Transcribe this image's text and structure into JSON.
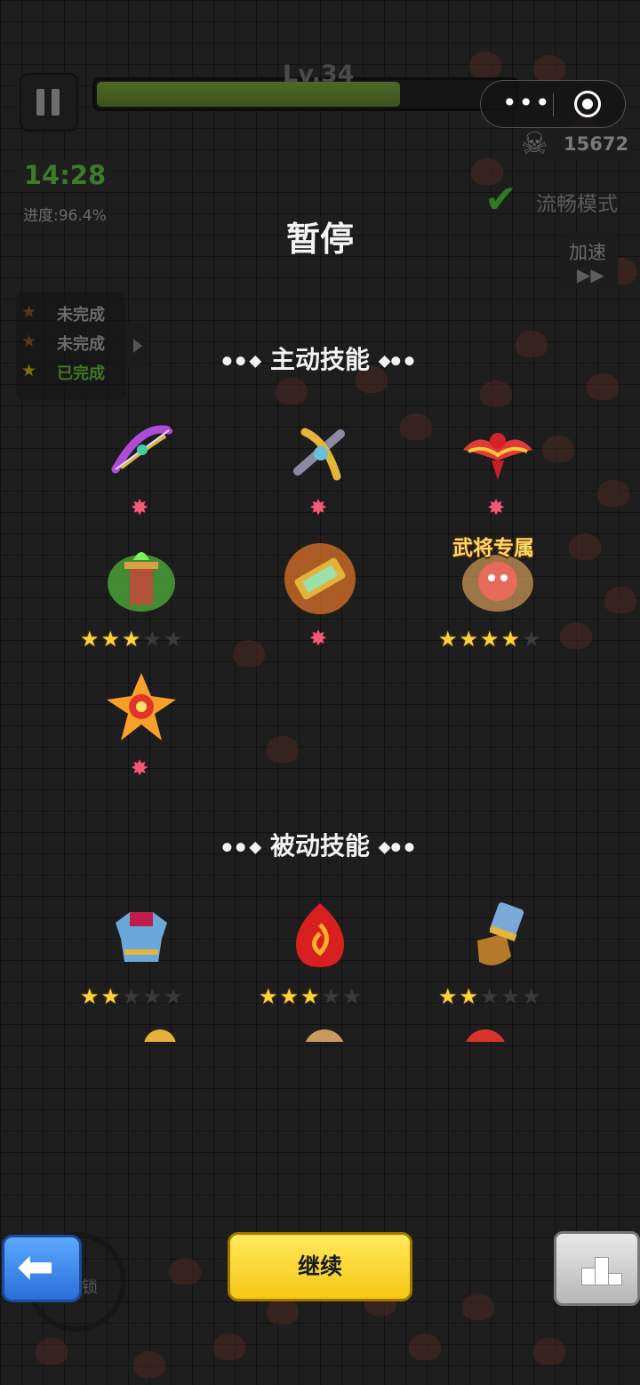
{
  "hud": {
    "level_label": "Lv.34",
    "level_progress": 0.72,
    "kill_count": "15672",
    "timer": "14:28",
    "progress_text": "进度:96.4%",
    "smooth_mode_label": "流畅模式",
    "speed_label": "加速",
    "speed_icon": "fast-forward-icon"
  },
  "quests": [
    {
      "label": "未完成",
      "status": "incomplete"
    },
    {
      "label": "未完成",
      "status": "incomplete"
    },
    {
      "label": "已完成",
      "status": "complete"
    }
  ],
  "pause": {
    "title": "暂停",
    "active_section": "主动技能",
    "passive_section": "被动技能",
    "exclusive_tag": "武将专属"
  },
  "active_skills": [
    {
      "icon": "purple-bow-icon",
      "stars": null,
      "marker": "pink-star"
    },
    {
      "icon": "golden-crossbow-icon",
      "stars": null,
      "marker": "pink-star"
    },
    {
      "icon": "red-phoenix-icon",
      "stars": null,
      "marker": "pink-star"
    },
    {
      "icon": "green-flame-altar-icon",
      "stars": 3,
      "max_stars": 5
    },
    {
      "icon": "jade-scroll-icon",
      "stars": null,
      "marker": "pink-star"
    },
    {
      "icon": "fire-beast-icon",
      "stars": 4,
      "max_stars": 5,
      "exclusive": true
    },
    {
      "icon": "fire-explosion-icon",
      "stars": null,
      "marker": "pink-star"
    }
  ],
  "passive_skills": [
    {
      "icon": "blue-armor-icon",
      "stars": 2,
      "max_stars": 5
    },
    {
      "icon": "fire-swirl-icon",
      "stars": 3,
      "max_stars": 5
    },
    {
      "icon": "gauntlet-icon",
      "stars": 2,
      "max_stars": 5
    }
  ],
  "buttons": {
    "continue_label": "继续",
    "lock_label": "锁",
    "back_icon": "back-arrow-icon",
    "rank_icon": "podium-icon"
  },
  "colors": {
    "continue_bg": "#f5c614",
    "back_bg": "#2a6ed8",
    "star_on": "#ffd23a",
    "star_off": "#3a3a3a",
    "level_marker": "#f05a78",
    "timer_green": "#3d7a2a",
    "exclusive_gold": "#ffd86a"
  }
}
